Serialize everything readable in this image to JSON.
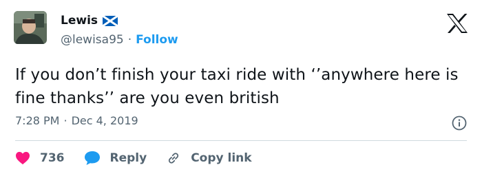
{
  "user": {
    "name": "Lewis",
    "handle": "@lewisa95",
    "separator": "·",
    "follow_label": "Follow",
    "flag_icon": "scotland-flag-icon"
  },
  "tweet": {
    "text": "If you don’t finish your taxi ride with ‘’anywhere here is fine thanks’’ are you even british",
    "time": "7:28 PM",
    "separator": "·",
    "date": "Dec 4, 2019"
  },
  "actions": {
    "like_count": "736",
    "reply_label": "Reply",
    "copy_label": "Copy link"
  },
  "colors": {
    "accent": "#1d9bf0",
    "like": "#f91880",
    "text": "#0f1419",
    "muted": "#536471",
    "flag_blue": "#005eb8"
  }
}
